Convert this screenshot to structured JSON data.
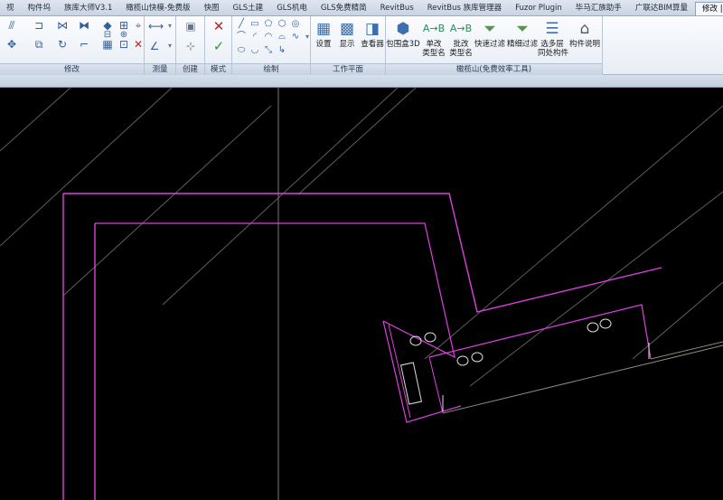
{
  "tabs": [
    {
      "label": "视"
    },
    {
      "label": "构件坞"
    },
    {
      "label": "族库大师V3.1"
    },
    {
      "label": "橄榄山快模-免费版"
    },
    {
      "label": "快图"
    },
    {
      "label": "GLS土建"
    },
    {
      "label": "GLS机电"
    },
    {
      "label": "GLS免费精简"
    },
    {
      "label": "RevitBus"
    },
    {
      "label": "RevitBus 族库管理器"
    },
    {
      "label": "Fuzor Plugin"
    },
    {
      "label": "毕马汇族助手"
    },
    {
      "label": "广联达BIM算量"
    },
    {
      "label": "修改 | 创建拉伸"
    }
  ],
  "panels": {
    "modify": "修改",
    "measure": "测量",
    "create": "创建",
    "mode": "模式",
    "draw": "绘制",
    "workplane": "工作平面",
    "gls": "橄榄山(免费效率工具)"
  },
  "workplane_buttons": {
    "set": "设置",
    "show": "显示",
    "viewer": "查看器"
  },
  "gls_buttons": {
    "box3d": "包围盒3D",
    "single_line1": "单改",
    "single_line2": "类型名",
    "batch_line1": "批改",
    "batch_line2": "类型名",
    "quick_filter": "快速过滤",
    "fine_filter": "精细过滤",
    "multi_line1": "选多层",
    "multi_line2": "同处构件",
    "describe": "构件说明"
  },
  "icons": {
    "finish_mode": "check-icon",
    "cancel_mode": "x-icon"
  },
  "colors": {
    "canvas_bg": "#000000",
    "wall_outline": "#e040e0",
    "grid_line": "#6e6e6e",
    "ribbon_bg": "#eef2f8"
  }
}
